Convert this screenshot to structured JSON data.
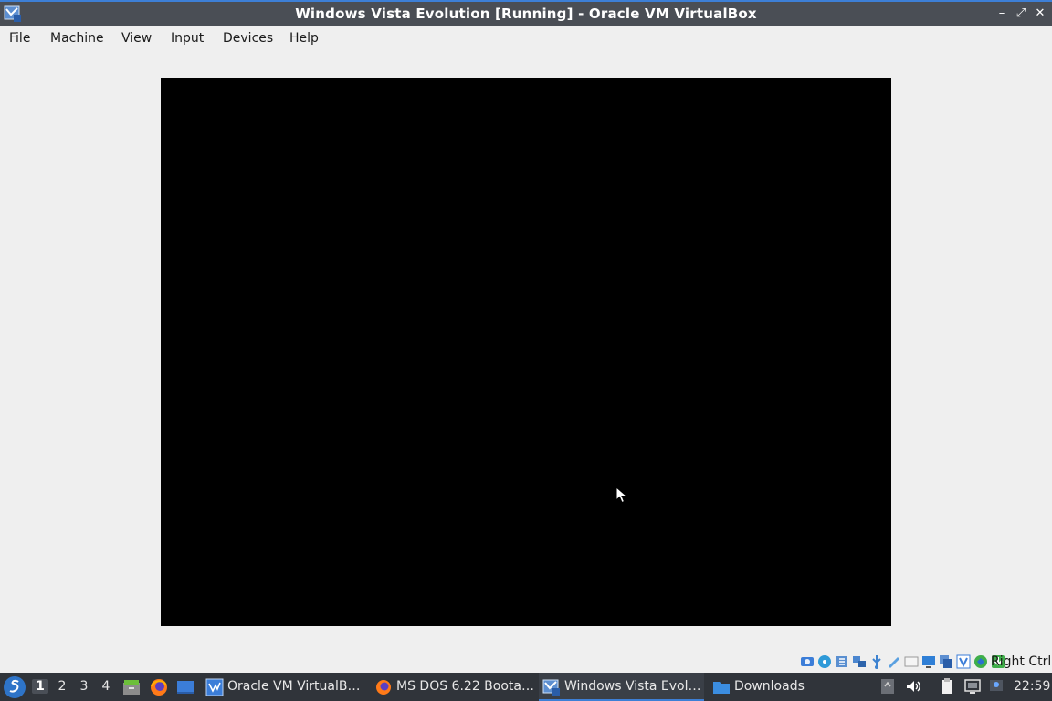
{
  "window": {
    "title": "Windows Vista Evolution [Running] - Oracle VM VirtualBox",
    "buttons": {
      "minimize": "–",
      "maximize": "⤢",
      "close": "✕"
    }
  },
  "menubar": {
    "items": [
      "File",
      "Machine",
      "View",
      "Input",
      "Devices",
      "Help"
    ]
  },
  "statusbar": {
    "icons": [
      "hard-disk-icon",
      "optical-drive-icon",
      "audio-icon",
      "network-icon",
      "usb-icon",
      "shared-folders-icon",
      "display-icon",
      "video-capture-icon",
      "virtualization-icon",
      "mouse-integration-icon",
      "keyboard-icon"
    ],
    "host_key": "Right Ctrl"
  },
  "taskbar": {
    "desktops": [
      "1",
      "2",
      "3",
      "4"
    ],
    "active_desktop": "1",
    "tasks": [
      {
        "label": "Oracle VM VirtualB…",
        "icon": "virtualbox-icon"
      },
      {
        "label": "MS DOS 6.22 Boota…",
        "icon": "firefox-icon"
      },
      {
        "label": "Windows Vista Evol…",
        "icon": "virtualbox-vm-icon"
      },
      {
        "label": "Downloads",
        "icon": "folder-icon"
      }
    ],
    "clock": "22:59"
  },
  "colors": {
    "titlebar_bg": "#4a4e55",
    "accent": "#3d7fd6",
    "taskbar_bg": "#30343a",
    "vm_screen": "#000000",
    "window_bg": "#efefef"
  }
}
